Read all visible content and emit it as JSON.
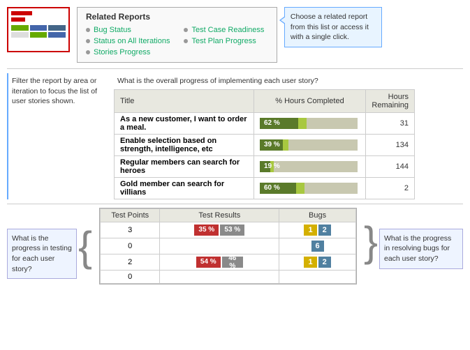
{
  "relatedReports": {
    "title": "Related Reports",
    "items": [
      {
        "label": "Bug Status",
        "col": 0
      },
      {
        "label": "Test Case Readiness",
        "col": 1
      },
      {
        "label": "Status on All Iterations",
        "col": 0
      },
      {
        "label": "Test Plan Progress",
        "col": 1
      },
      {
        "label": "Stories Progress",
        "col": 0
      }
    ]
  },
  "callout": {
    "text": "Choose a related report from this list or access it with a single click."
  },
  "filterAnnotation": {
    "text": "Filter the report by area or iteration to focus the list of user stories shown."
  },
  "progressAnnotation": {
    "text": "What is the overall progress of implementing each user story?"
  },
  "tableHeaders": {
    "title": "Title",
    "hoursCompleted": "% Hours Completed",
    "hoursRemaining": "Hours Remaining"
  },
  "stories": [
    {
      "title": "As a new customer, I want to order a meal.",
      "progress": 62,
      "darkWidth": 55,
      "lightWidth": 12,
      "hoursRemaining": 31
    },
    {
      "title": "Enable selection based on strength, intelligence, etc",
      "progress": 39,
      "darkWidth": 33,
      "lightWidth": 8,
      "hoursRemaining": 134
    },
    {
      "title": "Regular members can search for heroes",
      "progress": 19,
      "darkWidth": 15,
      "lightWidth": 5,
      "hoursRemaining": 144
    },
    {
      "title": "Gold member can search for villians",
      "progress": 60,
      "darkWidth": 52,
      "lightWidth": 12,
      "hoursRemaining": 2
    }
  ],
  "testAnnotationLeft": {
    "text": "What is the progress in testing for each user story?"
  },
  "testAnnotationRight": {
    "text": "What is the progress in resolving bugs for each user story?"
  },
  "testHeaders": {
    "testPoints": "Test Points",
    "testResults": "Test Results",
    "bugs": "Bugs"
  },
  "testRows": [
    {
      "testPoints": 3,
      "bar1Pct": "35 %",
      "bar1Width": 35,
      "bar2Pct": "53 %",
      "bar2Width": 35,
      "bug1": 1,
      "bug2": 2
    },
    {
      "testPoints": 0,
      "bar1Pct": "",
      "bar1Width": 0,
      "bar2Pct": "",
      "bar2Width": 0,
      "bug1": null,
      "bug2": 6
    },
    {
      "testPoints": 2,
      "bar1Pct": "54 %",
      "bar1Width": 35,
      "bar2Pct": "46 %",
      "bar2Width": 30,
      "bug1": 1,
      "bug2": 2
    },
    {
      "testPoints": 0,
      "bar1Pct": "",
      "bar1Width": 0,
      "bar2Pct": "",
      "bar2Width": 0,
      "bug1": null,
      "bug2": null
    }
  ]
}
